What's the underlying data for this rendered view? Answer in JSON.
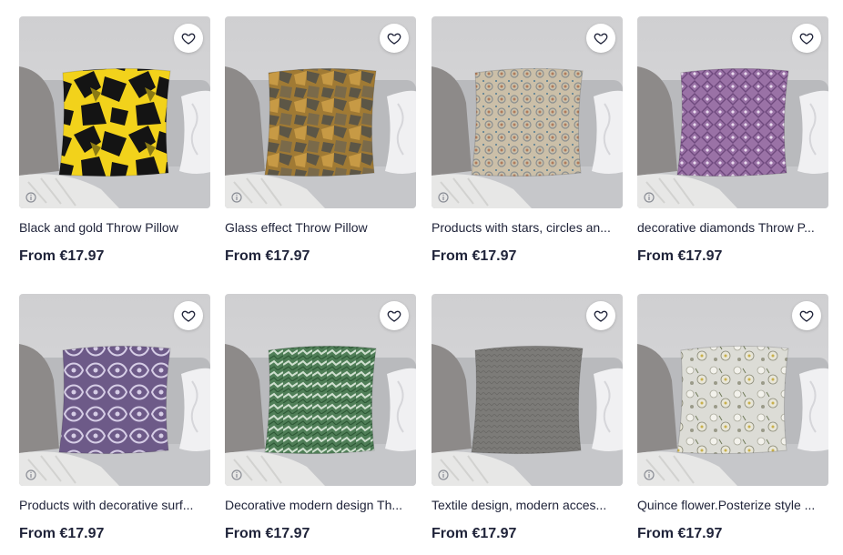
{
  "products": [
    {
      "title": "Black and gold Throw Pillow",
      "price": "From €17.97",
      "pattern": "black-gold-camo",
      "colors": [
        "#f2d21b",
        "#141414"
      ]
    },
    {
      "title": "Glass effect Throw Pillow",
      "price": "From €17.97",
      "pattern": "glass-mosaic",
      "colors": [
        "#a07a34",
        "#5c5646"
      ]
    },
    {
      "title": "Products with stars, circles an...",
      "price": "From €17.97",
      "pattern": "star-tile",
      "colors": [
        "#cbbfa8",
        "#8a8f90"
      ]
    },
    {
      "title": "decorative diamonds Throw P...",
      "price": "From €17.97",
      "pattern": "diamond-lattice",
      "colors": [
        "#9a72a6",
        "#6f4a7e"
      ]
    },
    {
      "title": "Products with decorative surf...",
      "price": "From €17.97",
      "pattern": "purple-swirl",
      "colors": [
        "#6d5a88",
        "#d6cde6"
      ]
    },
    {
      "title": "Decorative modern design Th...",
      "price": "From €17.97",
      "pattern": "green-weave",
      "colors": [
        "#4f7e57",
        "#cfe0cf"
      ]
    },
    {
      "title": "Textile design, modern acces...",
      "price": "From €17.97",
      "pattern": "grey-knit",
      "colors": [
        "#7c7b78",
        "#6a6966"
      ]
    },
    {
      "title": "Quince flower.Posterize style ...",
      "price": "From €17.97",
      "pattern": "quince-floral",
      "colors": [
        "#dcdcd6",
        "#a9a89a"
      ]
    }
  ],
  "icons": {
    "favorite": "heart-outline-icon",
    "info": "info-circle-icon"
  }
}
